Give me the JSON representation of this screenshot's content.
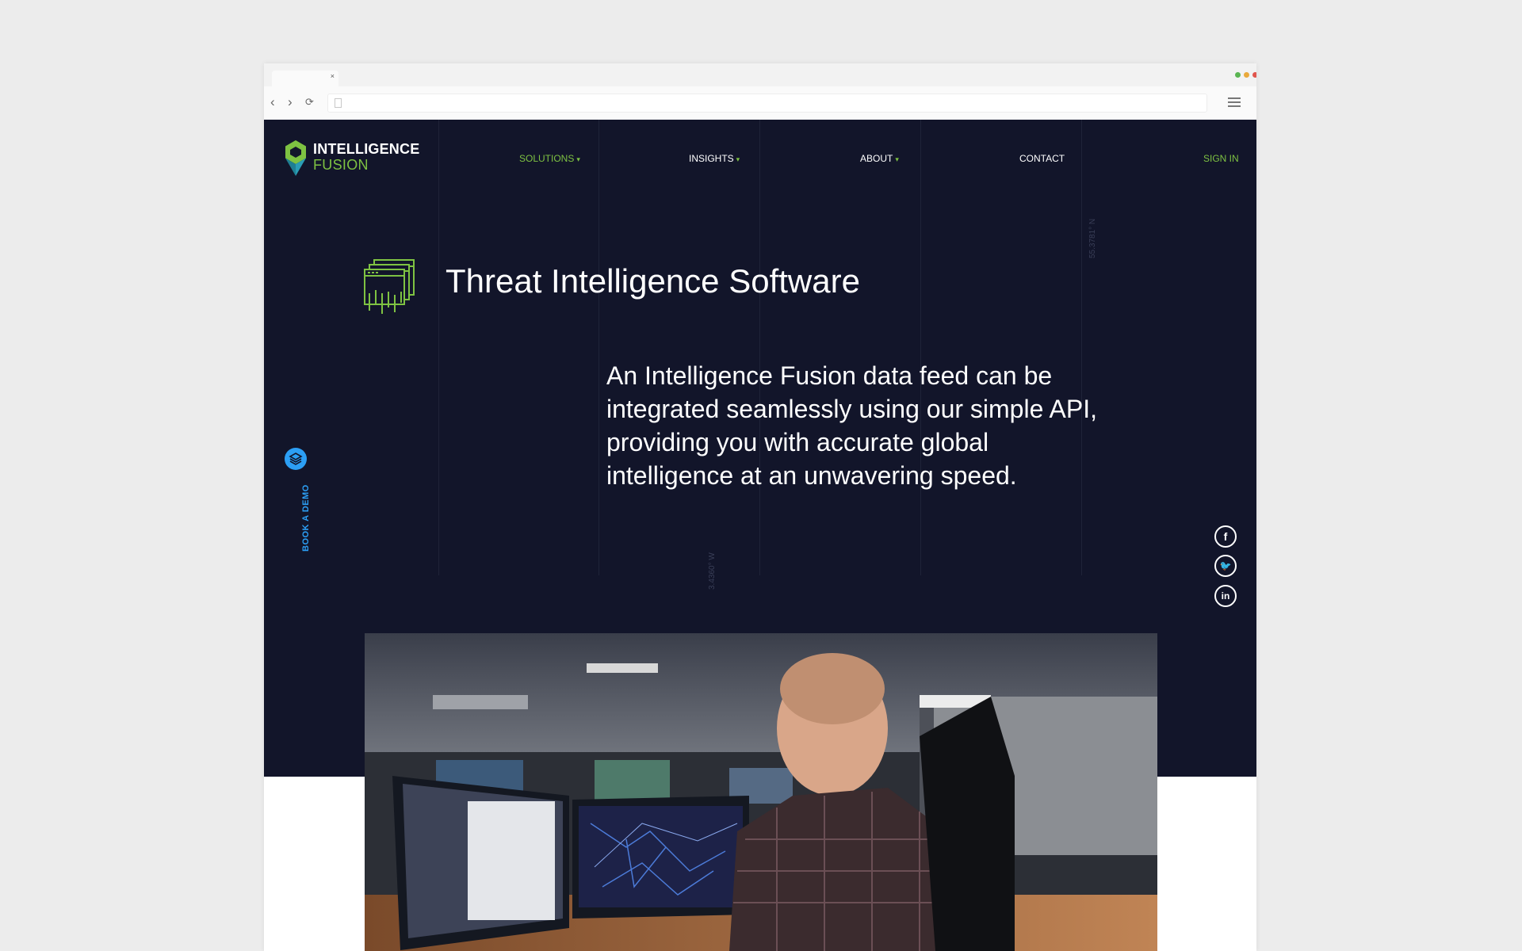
{
  "browser": {
    "tab_close": "×",
    "dots": [
      "#5ab552",
      "#e9a93c",
      "#e0554d"
    ]
  },
  "brand": {
    "name_line1": "INTELLIGENCE",
    "name_line2": "FUSION",
    "green": "#7ec242",
    "teal": "#2a9db5",
    "blue": "#2c9ff5",
    "navy": "#12152a"
  },
  "nav": {
    "items": [
      {
        "label": "SOLUTIONS",
        "caret": "▾",
        "active": true
      },
      {
        "label": "INSIGHTS",
        "caret": "▾"
      },
      {
        "label": "ABOUT",
        "caret": "▾"
      },
      {
        "label": "CONTACT"
      }
    ],
    "sign_in": "SIGN IN"
  },
  "coordinates": {
    "lat": "55.3781° N",
    "lon": "3.4360° W"
  },
  "hero": {
    "icon": "browser-windows-data-icon",
    "title": "Threat Intelligence Software",
    "lede": "An Intelligence Fusion data feed can be integrated seamlessly using our simple API, providing you with accurate global intelligence at an unwavering speed."
  },
  "demo": {
    "label": "BOOK A DEMO",
    "icon": "layers-icon"
  },
  "social": [
    {
      "label": "f",
      "icon": "facebook-icon"
    },
    {
      "label": "🐦",
      "icon": "twitter-icon"
    },
    {
      "label": "in",
      "icon": "linkedin-icon"
    }
  ]
}
